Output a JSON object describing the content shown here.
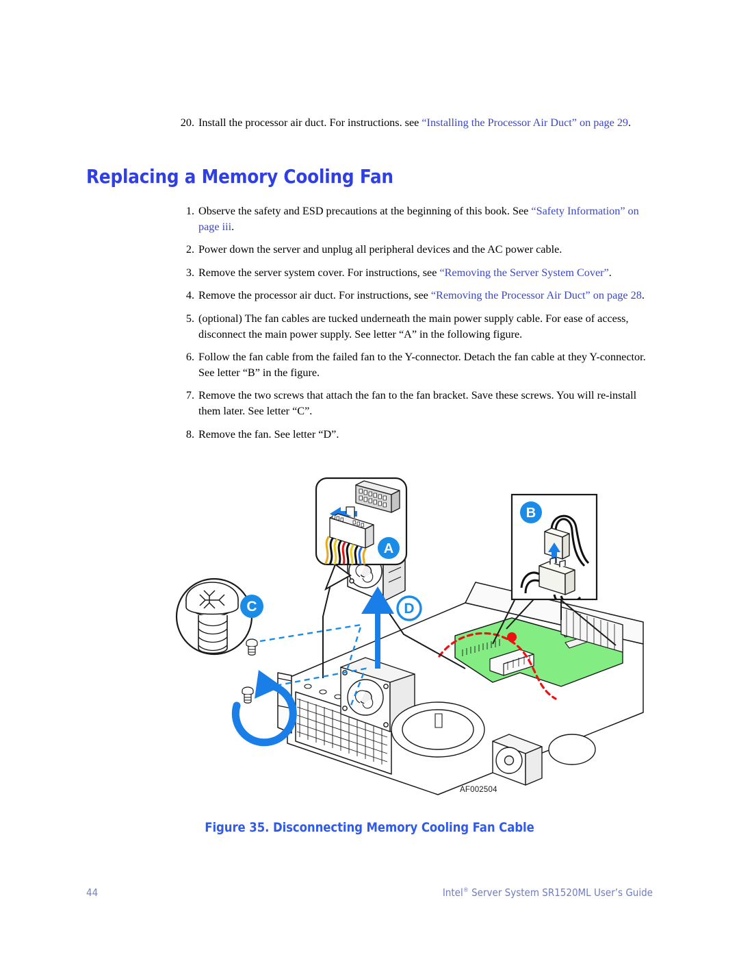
{
  "document": {
    "heading": "Replacing a Memory Cooling Fan",
    "heading_color": "#2f3fe3",
    "xref_color": "#3a46c8"
  },
  "top_list": [
    {
      "number": "20.",
      "segments": [
        {
          "text": "Install the processor air duct. For instructions. see ",
          "style": "plain"
        },
        {
          "text": "“Installing the Processor Air Duct” on page 29",
          "style": "xref"
        },
        {
          "text": ".",
          "style": "plain"
        }
      ]
    }
  ],
  "main_list": [
    {
      "number": "1.",
      "segments": [
        {
          "text": "Observe the safety and ESD precautions at the beginning of this book. See ",
          "style": "plain"
        },
        {
          "text": "“Safety Information” on page iii",
          "style": "xref"
        },
        {
          "text": ".",
          "style": "plain"
        }
      ]
    },
    {
      "number": "2.",
      "segments": [
        {
          "text": "Power down the server and unplug all peripheral devices and the AC power cable.",
          "style": "plain"
        }
      ]
    },
    {
      "number": "3.",
      "segments": [
        {
          "text": "Remove the server system cover. For instructions, see ",
          "style": "plain"
        },
        {
          "text": "“Removing the Server System Cover”",
          "style": "xref"
        },
        {
          "text": ".",
          "style": "plain"
        }
      ]
    },
    {
      "number": "4.",
      "segments": [
        {
          "text": "Remove the processor air duct. For instructions, see ",
          "style": "plain"
        },
        {
          "text": "“Removing the Processor Air Duct” on page 28",
          "style": "xref"
        },
        {
          "text": ".",
          "style": "plain"
        }
      ]
    },
    {
      "number": "5.",
      "segments": [
        {
          "text": "(optional) The fan cables are tucked underneath the main power supply cable. For ease of access, disconnect the main power supply. See letter “A” in the following figure.",
          "style": "plain"
        }
      ]
    },
    {
      "number": "6.",
      "segments": [
        {
          "text": "Follow the fan cable from the failed fan to the Y-connector. Detach the fan cable at they Y-connector. See letter “B” in the figure.",
          "style": "plain"
        }
      ]
    },
    {
      "number": "7.",
      "segments": [
        {
          "text": "Remove the two screws that attach the fan to the fan bracket. Save these screws. You will re-install them later. See letter “C”.",
          "style": "plain"
        }
      ]
    },
    {
      "number": "8.",
      "segments": [
        {
          "text": "Remove the fan. See letter “D”.",
          "style": "plain"
        }
      ]
    }
  ],
  "figure": {
    "id_label": "AF002504",
    "caption": "Figure 35. Disconnecting Memory Cooling Fan Cable",
    "callouts": [
      {
        "letter": "A",
        "meaning": "main-power-supply-connector"
      },
      {
        "letter": "B",
        "meaning": "fan-y-connector"
      },
      {
        "letter": "C",
        "meaning": "fan-mounting-screw"
      },
      {
        "letter": "D",
        "meaning": "fan-removal-direction"
      }
    ],
    "colors": {
      "callout_badge": "#1a8ce8",
      "arrow": "#1a7ee8",
      "pcb_green": "#7ee87e",
      "cable_path": "#ee1111",
      "outline": "#1a1a1a"
    }
  },
  "footer": {
    "page_number": "44",
    "title_prefix": "Intel",
    "title_mark": "®",
    "title_rest": " Server System SR1520ML User’s Guide"
  }
}
